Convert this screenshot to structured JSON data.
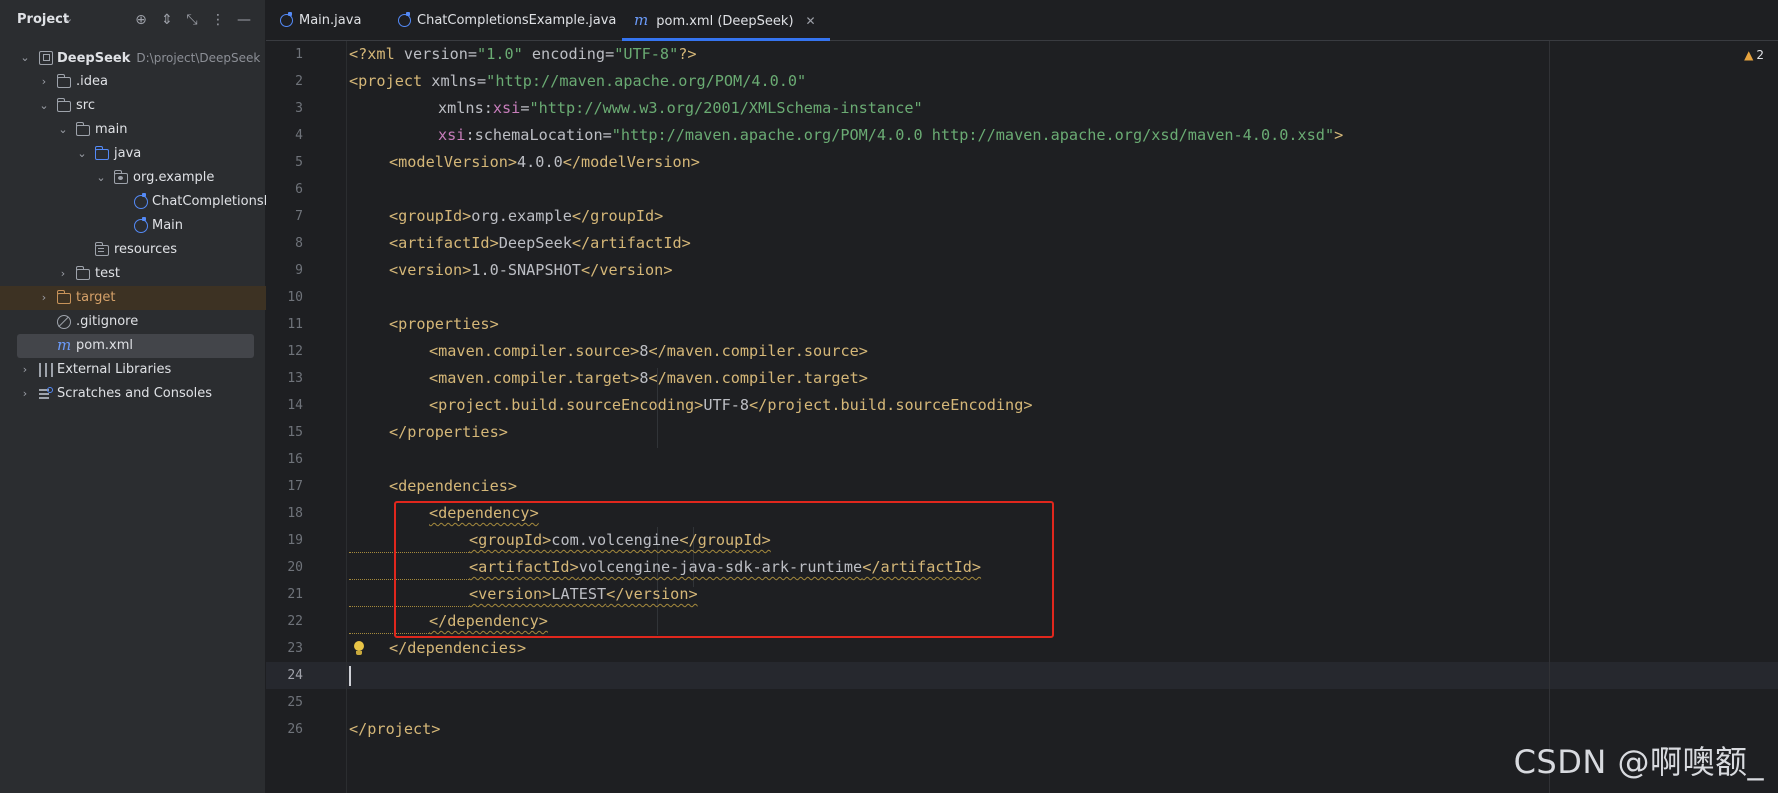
{
  "project_panel": {
    "title": "Project",
    "tree": [
      {
        "label": "DeepSeek",
        "extra": "D:\\project\\DeepSeek"
      },
      {
        "label": ".idea"
      },
      {
        "label": "src"
      },
      {
        "label": "main"
      },
      {
        "label": "java"
      },
      {
        "label": "org.example"
      },
      {
        "label": "ChatCompletionsEx"
      },
      {
        "label": "Main"
      },
      {
        "label": "resources"
      },
      {
        "label": "test"
      },
      {
        "label": "target"
      },
      {
        "label": ".gitignore"
      },
      {
        "label": "pom.xml"
      },
      {
        "label": "External Libraries"
      },
      {
        "label": "Scratches and Consoles"
      }
    ]
  },
  "tabs": [
    {
      "label": "Main.java"
    },
    {
      "label": "ChatCompletionsExample.java"
    },
    {
      "label": "pom.xml (DeepSeek)",
      "active": true
    }
  ],
  "editor": {
    "warning_count": "2",
    "current_line": "24",
    "line_numbers": [
      "1",
      "2",
      "3",
      "4",
      "5",
      "6",
      "7",
      "8",
      "9",
      "10",
      "11",
      "12",
      "13",
      "14",
      "15",
      "16",
      "17",
      "18",
      "19",
      "20",
      "21",
      "22",
      "23",
      "24",
      "25",
      "26"
    ],
    "code": {
      "l1": {
        "a": "<?xml ",
        "b": "version",
        "c": "=",
        "d": "\"1.0\"",
        "e": " encoding",
        "f": "=",
        "g": "\"UTF-8\"",
        "h": "?>"
      },
      "l2": {
        "a": "<project ",
        "b": "xmlns",
        "c": "=",
        "d": "\"http://maven.apache.org/POM/4.0.0\""
      },
      "l3": {
        "b": "xmlns:",
        "ns": "xsi",
        "c": "=",
        "d": "\"http://www.w3.org/2001/XMLSchema-instance\""
      },
      "l4": {
        "ns": "xsi",
        "b": ":schemaLocation",
        "c": "=",
        "d": "\"http://maven.apache.org/POM/4.0.0 http://maven.apache.org/xsd/maven-4.0.0.xsd\"",
        "e": ">"
      },
      "l5": {
        "open": "<modelVersion>",
        "text": "4.0.0",
        "close": "</modelVersion>"
      },
      "l7": {
        "open": "<groupId>",
        "text": "org.example",
        "close": "</groupId>"
      },
      "l8": {
        "open": "<artifactId>",
        "text": "DeepSeek",
        "close": "</artifactId>"
      },
      "l9": {
        "open": "<version>",
        "text": "1.0-SNAPSHOT",
        "close": "</version>"
      },
      "l11": {
        "open": "<properties>"
      },
      "l12": {
        "open": "<maven.compiler.source>",
        "text": "8",
        "close": "</maven.compiler.source>"
      },
      "l13": {
        "open": "<maven.compiler.target>",
        "text": "8",
        "close": "</maven.compiler.target>"
      },
      "l14": {
        "open": "<project.build.sourceEncoding>",
        "text": "UTF-8",
        "close": "</project.build.sourceEncoding>"
      },
      "l15": {
        "open": "</properties>"
      },
      "l17": {
        "open": "<dependencies>"
      },
      "l18": {
        "open": "<dependency>"
      },
      "l19": {
        "open": "<groupId>",
        "text": "com.volcengine",
        "close": "</groupId>"
      },
      "l20": {
        "open": "<artifactId>",
        "text": "volcengine-java-sdk-ark-runtime",
        "close": "</artifactId>"
      },
      "l21": {
        "open": "<version>",
        "text": "LATEST",
        "close": "</version>"
      },
      "l22": {
        "open": "</dependency>"
      },
      "l23": {
        "open": "</dependencies>"
      },
      "l26": {
        "open": "</project>"
      }
    }
  },
  "watermark": "CSDN @啊噢额_",
  "colors": {
    "tag": "#d5b778",
    "string": "#6aab73",
    "namespace": "#c77dbb",
    "highlight_box": "#e0271d",
    "accent": "#3574f0"
  }
}
